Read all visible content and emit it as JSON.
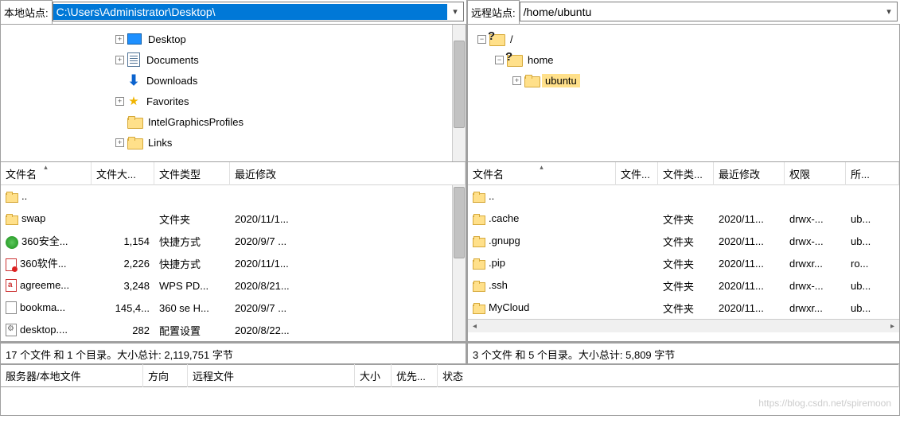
{
  "labels": {
    "local_site": "本地站点:",
    "remote_site": "远程站点:"
  },
  "paths": {
    "local": "C:\\Users\\Administrator\\Desktop\\",
    "remote": "/home/ubuntu"
  },
  "local_tree": [
    {
      "indent": 3,
      "expander": "+",
      "icon": "desktop",
      "label": "Desktop"
    },
    {
      "indent": 3,
      "expander": "+",
      "icon": "doc",
      "label": "Documents"
    },
    {
      "indent": 3,
      "expander": "",
      "icon": "down",
      "label": "Downloads"
    },
    {
      "indent": 3,
      "expander": "+",
      "icon": "star",
      "label": "Favorites"
    },
    {
      "indent": 3,
      "expander": "",
      "icon": "folder",
      "label": "IntelGraphicsProfiles"
    },
    {
      "indent": 3,
      "expander": "+",
      "icon": "folder",
      "label": "Links"
    }
  ],
  "remote_tree": [
    {
      "indent": 0,
      "expander": "-",
      "icon": "q",
      "label": "/"
    },
    {
      "indent": 1,
      "expander": "-",
      "icon": "q",
      "label": "home"
    },
    {
      "indent": 2,
      "expander": "+",
      "icon": "folder",
      "label": "ubuntu",
      "selected": true
    }
  ],
  "list_headers": {
    "local": {
      "name": "文件名",
      "size": "文件大...",
      "type": "文件类型",
      "modified": "最近修改"
    },
    "remote": {
      "name": "文件名",
      "size": "文件...",
      "type": "文件类...",
      "modified": "最近修改",
      "perm": "权限",
      "owner": "所..."
    }
  },
  "local_files": [
    {
      "icon": "folder",
      "name": "..",
      "size": "",
      "type": "",
      "modified": ""
    },
    {
      "icon": "folder",
      "name": "swap",
      "size": "",
      "type": "文件夹",
      "modified": "2020/11/1..."
    },
    {
      "icon": "green",
      "name": "360安全...",
      "size": "1,154",
      "type": "快捷方式",
      "modified": "2020/9/7 ..."
    },
    {
      "icon": "red",
      "name": "360软件...",
      "size": "2,226",
      "type": "快捷方式",
      "modified": "2020/11/1..."
    },
    {
      "icon": "pdf",
      "name": "agreeme...",
      "size": "3,248",
      "type": "WPS PD...",
      "modified": "2020/8/21..."
    },
    {
      "icon": "html",
      "name": "bookma...",
      "size": "145,4...",
      "type": "360 se H...",
      "modified": "2020/9/7 ..."
    },
    {
      "icon": "ini",
      "name": "desktop....",
      "size": "282",
      "type": "配置设置",
      "modified": "2020/8/22..."
    }
  ],
  "remote_files": [
    {
      "icon": "folder",
      "name": "..",
      "size": "",
      "type": "",
      "modified": "",
      "perm": "",
      "owner": ""
    },
    {
      "icon": "folder",
      "name": ".cache",
      "size": "",
      "type": "文件夹",
      "modified": "2020/11...",
      "perm": "drwx-...",
      "owner": "ub..."
    },
    {
      "icon": "folder",
      "name": ".gnupg",
      "size": "",
      "type": "文件夹",
      "modified": "2020/11...",
      "perm": "drwx-...",
      "owner": "ub..."
    },
    {
      "icon": "folder",
      "name": ".pip",
      "size": "",
      "type": "文件夹",
      "modified": "2020/11...",
      "perm": "drwxr...",
      "owner": "ro..."
    },
    {
      "icon": "folder",
      "name": ".ssh",
      "size": "",
      "type": "文件夹",
      "modified": "2020/11...",
      "perm": "drwx-...",
      "owner": "ub..."
    },
    {
      "icon": "folder",
      "name": "MyCloud",
      "size": "",
      "type": "文件夹",
      "modified": "2020/11...",
      "perm": "drwxr...",
      "owner": "ub..."
    }
  ],
  "status": {
    "local": "17 个文件 和 1 个目录。大小总计: 2,119,751 字节",
    "remote": "3 个文件 和 5 个目录。大小总计: 5,809 字节"
  },
  "queue_headers": {
    "server_local": "服务器/本地文件",
    "direction": "方向",
    "remote_file": "远程文件",
    "size": "大小",
    "priority": "优先...",
    "status": "状态"
  },
  "watermark": "https://blog.csdn.net/spiremoon",
  "col_widths": {
    "local": {
      "name": 114,
      "size": 79,
      "type": 95,
      "modified": 260
    },
    "remote": {
      "name": 186,
      "size": 53,
      "type": 70,
      "modified": 89,
      "perm": 77,
      "owner": 50
    }
  }
}
